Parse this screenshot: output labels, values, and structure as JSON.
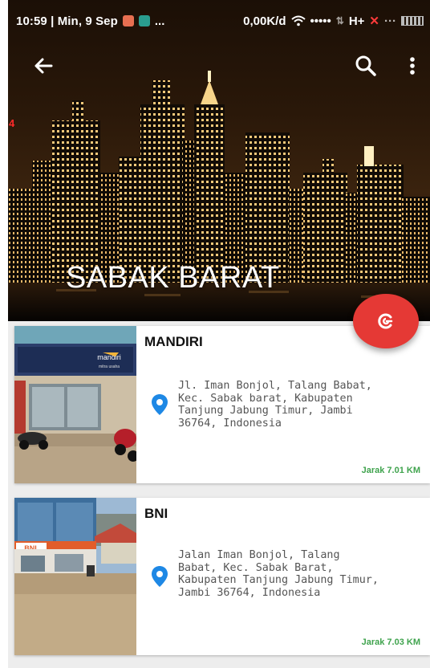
{
  "statusbar": {
    "time": "10:59 | Min, 9 Sep",
    "ellipsis": "...",
    "network": "0,00K/d",
    "signal_dots": "•••••",
    "net_type": "H+",
    "x_mark": "✕",
    "x_dots": "···"
  },
  "toolbar": {
    "back_icon": "arrow-back-icon",
    "search_icon": "search-icon",
    "more_icon": "more-vert-icon"
  },
  "side_mark": "4",
  "header": {
    "title": "SABAK BARAT"
  },
  "fab": {
    "icon": "refresh-icon",
    "color": "#e53935"
  },
  "banks": [
    {
      "name": "MANDIRI",
      "address": "Jl. Iman Bonjol, Talang Babat,\nKec. Sabak barat, Kabupaten\nTanjung Jabung Timur, Jambi\n36764, Indonesia",
      "distance": "Jarak 7.01 KM",
      "sign_text": "mandiri",
      "sign_sub": "mitra usaha"
    },
    {
      "name": "BNI",
      "address": "Jalan Iman Bonjol, Talang\nBabat, Kec. Sabak Barat,\nKabupaten Tanjung Jabung Timur,\nJambi 36764, Indonesia",
      "distance": "Jarak 7.03 KM",
      "sign_text": "BNI"
    }
  ],
  "colors": {
    "accent": "#e53935",
    "distance": "#3fa34d",
    "pin": "#1e88e5"
  }
}
